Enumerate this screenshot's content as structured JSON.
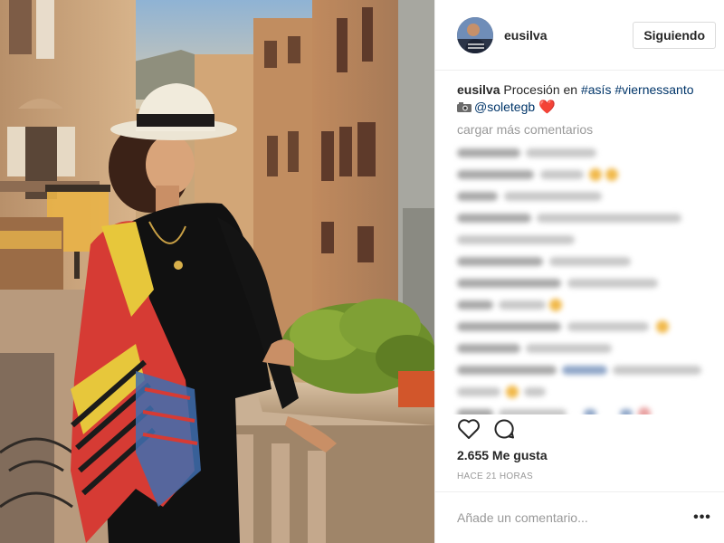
{
  "post": {
    "photo_alt": "Foto",
    "author": {
      "username": "eusilva",
      "follow_label": "Siguiendo"
    },
    "caption": {
      "username": "eusilva",
      "text_1": " Procesión en ",
      "hashtag_1": "#asís",
      "hashtag_2": "#viernessanto",
      "camera_icon": "camera-emoji",
      "mention": "@soletegb",
      "heart_icon": "red-heart-emoji",
      "heart": "❤️"
    },
    "load_more_label": "cargar más comentarios",
    "likes_text": "2.655 Me gusta",
    "timestamp": "HACE 21 HORAS",
    "comment_input": {
      "placeholder": "Añade un comentario..."
    },
    "more_label": "•••",
    "accent_colors": {
      "link": "#003569",
      "muted": "#999999",
      "heart": "#d0021b"
    }
  }
}
